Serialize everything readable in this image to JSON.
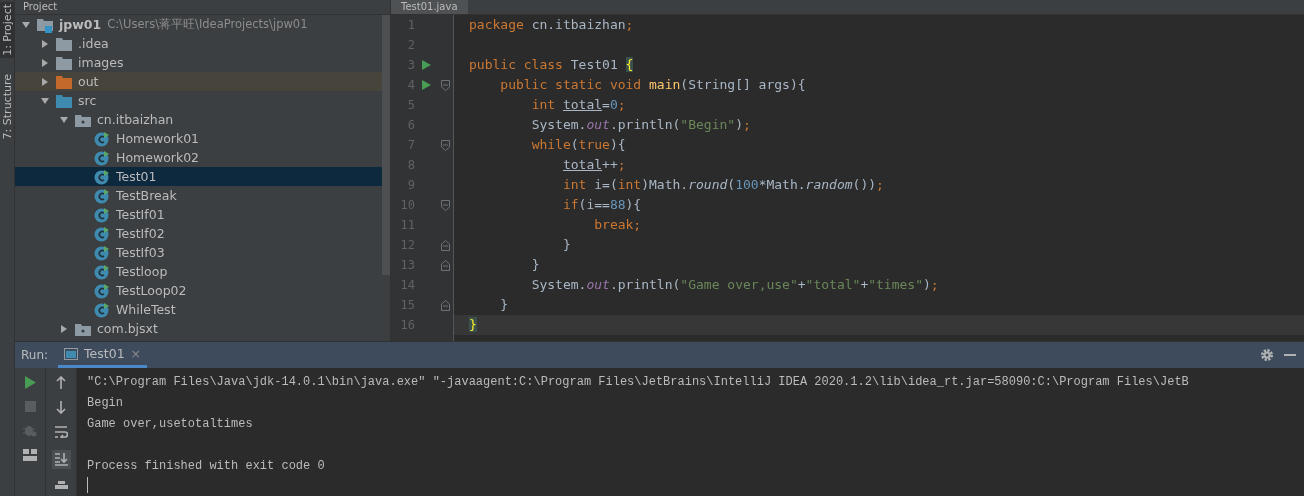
{
  "tool_strip": [
    {
      "label": "1: Project",
      "selected": true
    },
    {
      "label": "7: Structure",
      "selected": false
    }
  ],
  "project_panel": {
    "title": "Project",
    "tree": [
      {
        "name": "jpw01",
        "path": "C:\\Users\\蒋平旺\\IdeaProjects\\jpw01",
        "kind": "module",
        "expanded": true,
        "selected": false,
        "children": [
          {
            "name": ".idea",
            "kind": "folder",
            "expanded": false,
            "selected": false
          },
          {
            "name": "images",
            "kind": "folder",
            "expanded": false,
            "selected": false
          },
          {
            "name": "out",
            "kind": "excluded",
            "expanded": false,
            "selected": false
          },
          {
            "name": "src",
            "kind": "source",
            "expanded": true,
            "selected": false,
            "children": [
              {
                "name": "cn.itbaizhan",
                "kind": "package",
                "expanded": true,
                "selected": false,
                "children": [
                  {
                    "name": "Homework01",
                    "kind": "class",
                    "selected": false
                  },
                  {
                    "name": "Homework02",
                    "kind": "class",
                    "selected": false
                  },
                  {
                    "name": "Test01",
                    "kind": "class",
                    "selected": true
                  },
                  {
                    "name": "TestBreak",
                    "kind": "class",
                    "selected": false
                  },
                  {
                    "name": "TestIf01",
                    "kind": "class",
                    "selected": false
                  },
                  {
                    "name": "TestIf02",
                    "kind": "class",
                    "selected": false
                  },
                  {
                    "name": "TestIf03",
                    "kind": "class",
                    "selected": false
                  },
                  {
                    "name": "Testloop",
                    "kind": "class",
                    "selected": false
                  },
                  {
                    "name": "TestLoop02",
                    "kind": "class",
                    "selected": false
                  },
                  {
                    "name": "WhileTest",
                    "kind": "class",
                    "selected": false
                  }
                ]
              },
              {
                "name": "com.bjsxt",
                "kind": "package",
                "expanded": false,
                "selected": false
              }
            ]
          }
        ]
      }
    ]
  },
  "editor": {
    "tab": "Test01.java",
    "lines": [
      {
        "number": "1",
        "run": false,
        "current": false,
        "fold_start": false,
        "fold_end": false,
        "segments": [
          {
            "kind": "kw",
            "text": "package "
          },
          {
            "kind": "plain",
            "text": "cn.itbaizhan"
          },
          {
            "kind": "kw",
            "text": ";"
          }
        ]
      },
      {
        "number": "2",
        "run": false,
        "current": false,
        "fold_start": false,
        "fold_end": false
      },
      {
        "number": "3",
        "run": true,
        "current": false,
        "fold_start": false,
        "fold_end": false,
        "segments": [
          {
            "kind": "kw",
            "text": "public class "
          },
          {
            "kind": "plain",
            "text": "Test01 "
          },
          {
            "kind": "brace",
            "text": "{"
          }
        ]
      },
      {
        "number": "4",
        "run": true,
        "current": false,
        "fold_start": true,
        "fold_end": false,
        "segments": [
          {
            "kind": "kw",
            "text": "    public static void "
          },
          {
            "kind": "method",
            "text": "main"
          },
          {
            "kind": "plain",
            "text": "(String[] args){"
          }
        ]
      },
      {
        "number": "5",
        "run": false,
        "current": false,
        "fold_start": false,
        "fold_end": false,
        "segments": [
          {
            "kind": "kw",
            "text": "        int "
          },
          {
            "kind": "var",
            "text": "total"
          },
          {
            "kind": "plain",
            "text": "="
          },
          {
            "kind": "num",
            "text": "0"
          },
          {
            "kind": "kw",
            "text": ";"
          }
        ]
      },
      {
        "number": "6",
        "run": false,
        "current": false,
        "fold_start": false,
        "fold_end": false,
        "segments": [
          {
            "kind": "plain",
            "text": "        System."
          },
          {
            "kind": "field",
            "text": "out"
          },
          {
            "kind": "plain",
            "text": ".println("
          },
          {
            "kind": "str",
            "text": "\"Begin\""
          },
          {
            "kind": "plain",
            "text": ")"
          },
          {
            "kind": "kw",
            "text": ";"
          }
        ]
      },
      {
        "number": "7",
        "run": false,
        "current": false,
        "fold_start": true,
        "fold_end": false,
        "segments": [
          {
            "kind": "kw",
            "text": "        while"
          },
          {
            "kind": "plain",
            "text": "("
          },
          {
            "kind": "kw",
            "text": "true"
          },
          {
            "kind": "plain",
            "text": "){"
          }
        ]
      },
      {
        "number": "8",
        "run": false,
        "current": false,
        "fold_start": false,
        "fold_end": false,
        "segments": [
          {
            "kind": "var",
            "text": "            total"
          },
          {
            "kind": "plain",
            "text": "++"
          },
          {
            "kind": "kw",
            "text": ";"
          }
        ]
      },
      {
        "number": "9",
        "run": false,
        "current": false,
        "fold_start": false,
        "fold_end": false,
        "segments": [
          {
            "kind": "kw",
            "text": "            int "
          },
          {
            "kind": "plain",
            "text": "i=("
          },
          {
            "kind": "kw",
            "text": "int"
          },
          {
            "kind": "plain",
            "text": ")Math."
          },
          {
            "kind": "call",
            "text": "round"
          },
          {
            "kind": "plain",
            "text": "("
          },
          {
            "kind": "num",
            "text": "100"
          },
          {
            "kind": "plain",
            "text": "*Math."
          },
          {
            "kind": "call",
            "text": "random"
          },
          {
            "kind": "plain",
            "text": "())"
          },
          {
            "kind": "kw",
            "text": ";"
          }
        ]
      },
      {
        "number": "10",
        "run": false,
        "current": false,
        "fold_start": true,
        "fold_end": false,
        "segments": [
          {
            "kind": "kw",
            "text": "            if"
          },
          {
            "kind": "plain",
            "text": "(i=="
          },
          {
            "kind": "num",
            "text": "88"
          },
          {
            "kind": "plain",
            "text": "){"
          }
        ]
      },
      {
        "number": "11",
        "run": false,
        "current": false,
        "fold_start": false,
        "fold_end": false,
        "segments": [
          {
            "kind": "kw",
            "text": "                break;"
          }
        ]
      },
      {
        "number": "12",
        "run": false,
        "current": false,
        "fold_start": false,
        "fold_end": true,
        "segments": [
          {
            "kind": "plain",
            "text": "            }"
          }
        ]
      },
      {
        "number": "13",
        "run": false,
        "current": false,
        "fold_start": false,
        "fold_end": true,
        "segments": [
          {
            "kind": "plain",
            "text": "        }"
          }
        ]
      },
      {
        "number": "14",
        "run": false,
        "current": false,
        "fold_start": false,
        "fold_end": false,
        "segments": [
          {
            "kind": "plain",
            "text": "        System."
          },
          {
            "kind": "field",
            "text": "out"
          },
          {
            "kind": "plain",
            "text": ".println("
          },
          {
            "kind": "str",
            "text": "\"Game over,use\""
          },
          {
            "kind": "plain",
            "text": "+"
          },
          {
            "kind": "str",
            "text": "\"total\""
          },
          {
            "kind": "plain",
            "text": "+"
          },
          {
            "kind": "str",
            "text": "\"times\""
          },
          {
            "kind": "plain",
            "text": ")"
          },
          {
            "kind": "kw",
            "text": ";"
          }
        ]
      },
      {
        "number": "15",
        "run": false,
        "current": false,
        "fold_start": false,
        "fold_end": true,
        "segments": [
          {
            "kind": "plain",
            "text": "    }"
          }
        ]
      },
      {
        "number": "16",
        "run": false,
        "current": true,
        "fold_start": false,
        "fold_end": false,
        "segments": [
          {
            "kind": "brace",
            "text": "}"
          }
        ]
      }
    ]
  },
  "run_panel": {
    "label": "Run:",
    "tabs": [
      {
        "label": "Test01",
        "selected": true
      }
    ],
    "close": "×",
    "console": [
      {
        "text": "\"C:\\Program Files\\Java\\jdk-14.0.1\\bin\\java.exe\" \"-javaagent:C:\\Program Files\\JetBrains\\IntelliJ IDEA 2020.1.2\\lib\\idea_rt.jar=58090:C:\\Program Files\\JetB",
        "gap_before": false
      },
      {
        "text": "Begin",
        "gap_before": false
      },
      {
        "text": "Game over,usetotaltimes",
        "gap_before": false
      },
      {
        "text": "Process finished with exit code 0",
        "gap_before": true
      }
    ]
  }
}
